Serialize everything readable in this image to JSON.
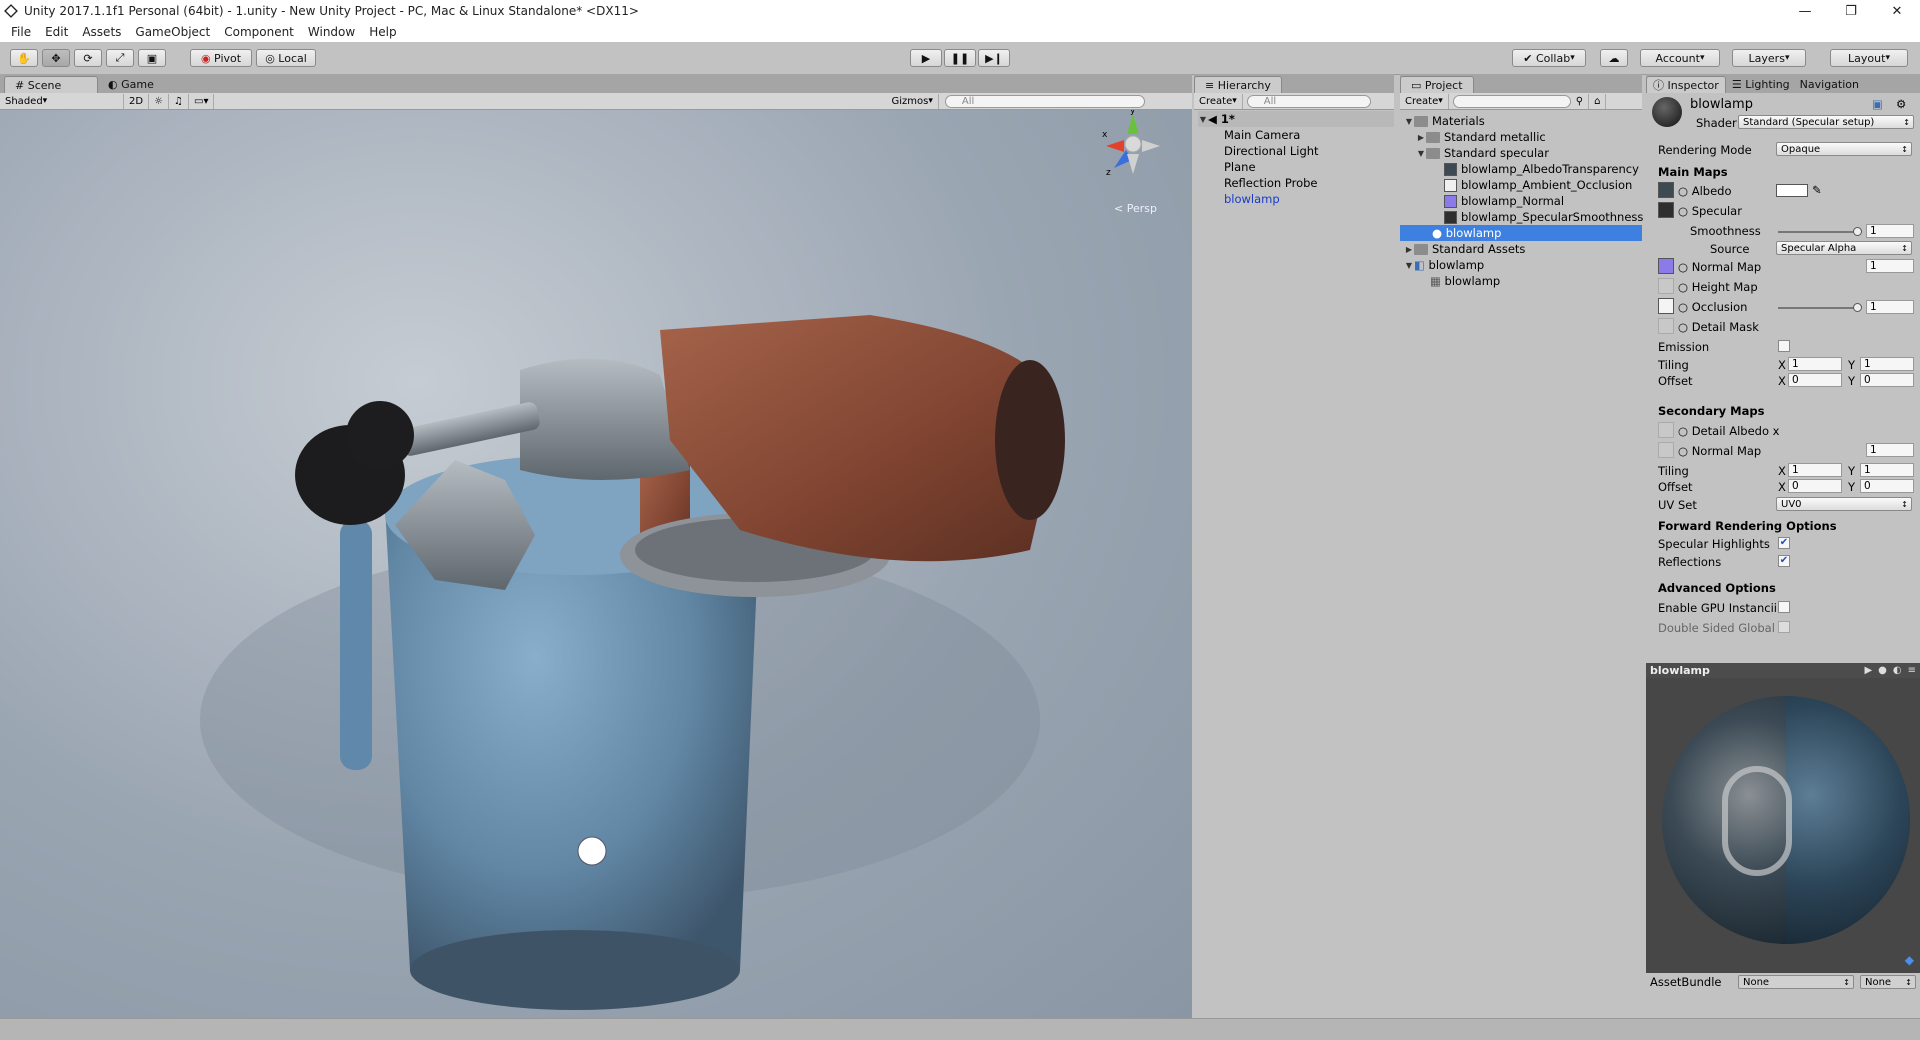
{
  "window": {
    "title": "Unity 2017.1.1f1 Personal (64bit) - 1.unity - New Unity Project - PC, Mac & Linux Standalone* <DX11>",
    "minimize": "—",
    "maximize": "❐",
    "close": "✕"
  },
  "menu": [
    "File",
    "Edit",
    "Assets",
    "GameObject",
    "Component",
    "Window",
    "Help"
  ],
  "toolbar": {
    "pivot": "Pivot",
    "local": "Local",
    "collab": "Collab",
    "account": "Account",
    "layers": "Layers",
    "layout": "Layout"
  },
  "scene": {
    "tab_scene": "Scene",
    "tab_game": "Game",
    "shading": "Shaded",
    "mode_2d": "2D",
    "gizmos": "Gizmos",
    "search_placeholder": "All",
    "persp": "< Persp",
    "axis_y": "y",
    "axis_x": "x",
    "axis_z": "z"
  },
  "hierarchy": {
    "tab": "Hierarchy",
    "create": "Create",
    "search_placeholder": "All",
    "scene_name": "1*",
    "items": [
      "Main Camera",
      "Directional Light",
      "Plane",
      "Reflection Probe",
      "blowlamp"
    ]
  },
  "project": {
    "tab": "Project",
    "create": "Create",
    "tree": {
      "materials": "Materials",
      "standard_metallic": "Standard metallic",
      "standard_specular": "Standard specular",
      "textures": [
        "blowlamp_AlbedoTransparency",
        "blowlamp_Ambient_Occlusion",
        "blowlamp_Normal",
        "blowlamp_SpecularSmoothness"
      ],
      "selected_material": "blowlamp",
      "standard_assets": "Standard Assets",
      "model": "blowlamp",
      "mesh": "blowlamp"
    }
  },
  "inspector": {
    "tabs": [
      "Inspector",
      "Lighting",
      "Navigation"
    ],
    "material_name": "blowlamp",
    "shader_label": "Shader",
    "shader_value": "Standard (Specular setup)",
    "rendering_mode_label": "Rendering Mode",
    "rendering_mode_value": "Opaque",
    "main_maps": "Main Maps",
    "albedo": "Albedo",
    "specular": "Specular",
    "smoothness": "Smoothness",
    "smoothness_value": "1",
    "source": "Source",
    "source_value": "Specular Alpha",
    "normal_map": "Normal Map",
    "normal_value": "1",
    "height_map": "Height Map",
    "occlusion": "Occlusion",
    "occlusion_value": "1",
    "detail_mask": "Detail Mask",
    "emission": "Emission",
    "tiling": "Tiling",
    "offset": "Offset",
    "x": "X",
    "y": "Y",
    "tiling_x": "1",
    "tiling_y": "1",
    "offset_x": "0",
    "offset_y": "0",
    "secondary_maps": "Secondary Maps",
    "detail_albedo": "Detail Albedo x",
    "sec_normal_map": "Normal Map",
    "sec_normal_value": "1",
    "sec_tiling_x": "1",
    "sec_tiling_y": "1",
    "sec_offset_x": "0",
    "sec_offset_y": "0",
    "uv_set": "UV Set",
    "uv_set_value": "UV0",
    "forward_options": "Forward Rendering Options",
    "specular_highlights": "Specular Highlights",
    "reflections": "Reflections",
    "advanced_options": "Advanced Options",
    "gpu_instancing": "Enable GPU Instancii",
    "double_sided": "Double Sided Global",
    "preview_title": "blowlamp",
    "asset_bundle": "AssetBundle",
    "bundle_none": "None",
    "variant_none": "None"
  },
  "colors": {
    "accent": "#3d80df",
    "rust": "#8a4a32",
    "steel_blue": "#6f98b8"
  }
}
